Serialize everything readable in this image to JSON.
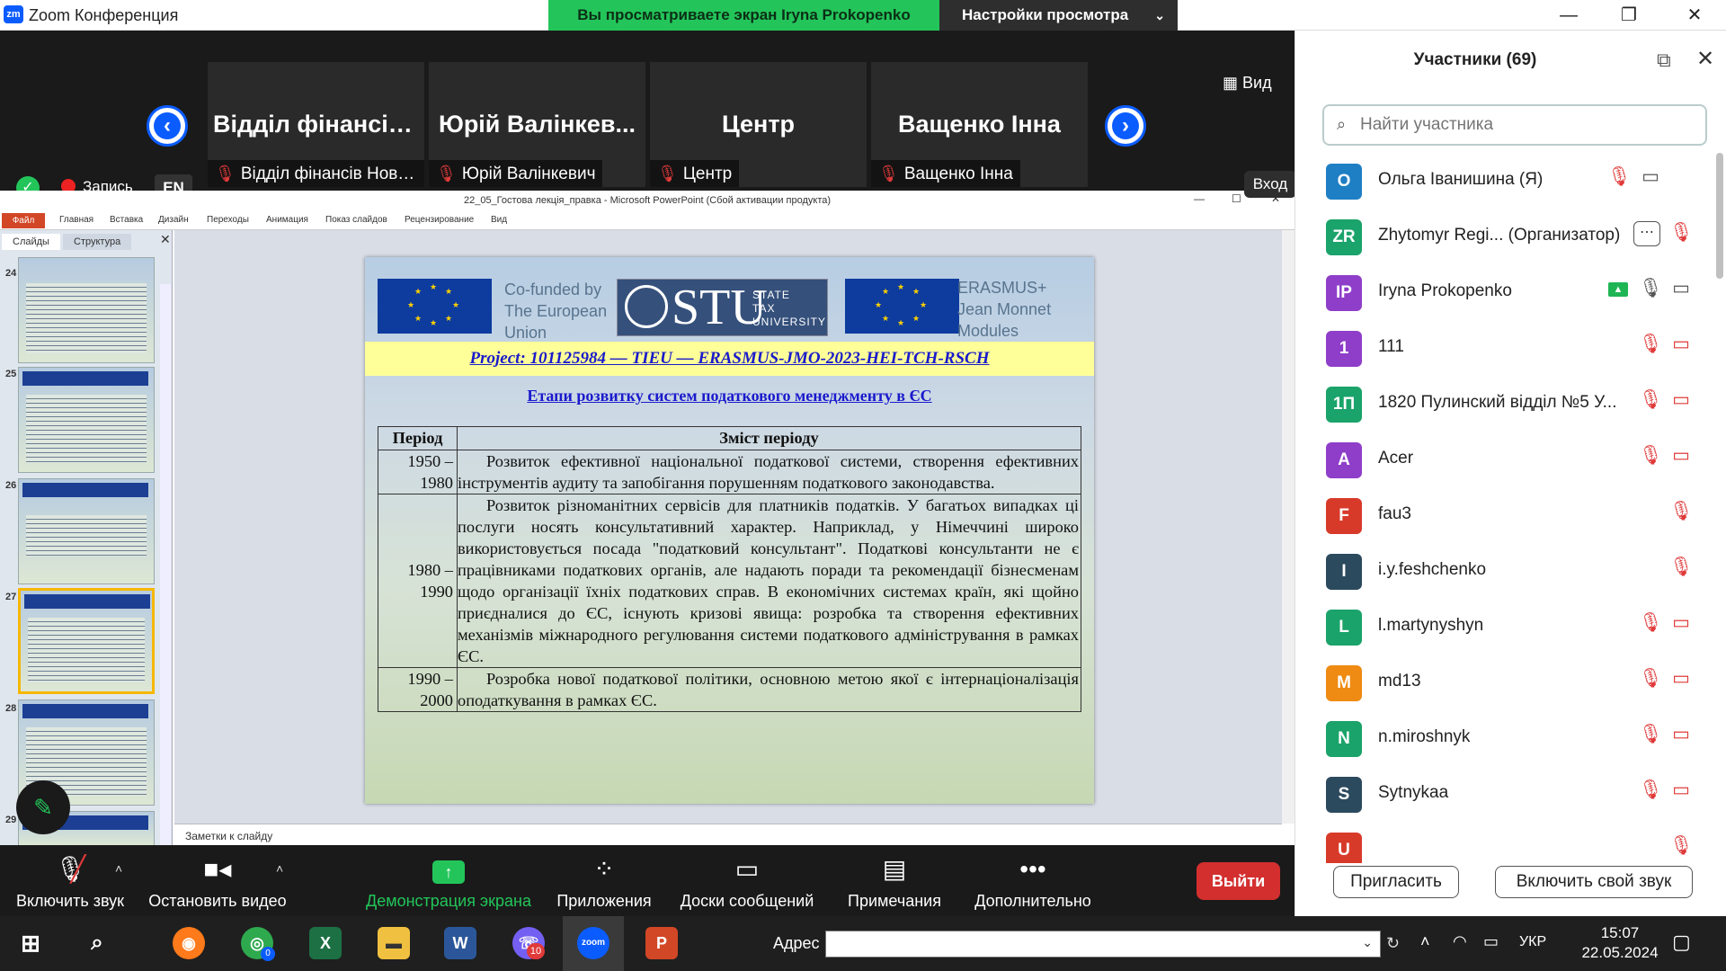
{
  "window": {
    "app_title": "Zoom Конференция",
    "share_banner": "Вы просматриваете экран Iryna Prokopenko",
    "view_options": "Настройки просмотра",
    "minimize": "—",
    "maximize": "❐",
    "close": "✕"
  },
  "gallery": {
    "view_label": "Вид",
    "enter_label": "Вход",
    "recording": "Запись",
    "language": "EN",
    "tiles": [
      {
        "big": "Відділ фінансів...",
        "label": "Відділ фінансів Новог..."
      },
      {
        "big": "Юрій Валінкев...",
        "label": "Юрій Валінкевич"
      },
      {
        "big": "Центр",
        "label": "Центр"
      },
      {
        "big": "Ващенко Інна",
        "label": "Ващенко Інна"
      }
    ]
  },
  "ppt": {
    "window_title": "22_05_Гостова лекція_правка - Microsoft PowerPoint (Сбой активации продукта)",
    "ribbon_tabs": [
      "Главная",
      "Вставка",
      "Дизайн",
      "Переходы",
      "Анимация",
      "Показ слайдов",
      "Рецензирование",
      "Вид"
    ],
    "file_tab": "Файл",
    "panel_tabs": [
      "Слайды",
      "Структура"
    ],
    "slide_numbers": [
      "24",
      "25",
      "26",
      "27",
      "28",
      "29"
    ],
    "notes_placeholder": "Заметки к слайду"
  },
  "slide": {
    "cofunded": [
      "Co-funded by",
      "The European",
      "Union"
    ],
    "stu_logo": "STU",
    "stu_sub": [
      "STATE",
      "TAX",
      "UNIVERSITY"
    ],
    "erasmus": [
      "ERASMUS+",
      "Jean Monnet",
      "Modules"
    ],
    "project": "Project:  101125984 — TIEU — ERASMUS-JMO-2023-HEI-TCH-RSCH",
    "title": "Етапи розвитку систем податкового менеджменту в ЄС",
    "header_period": "Період",
    "header_content": "Зміст періоду",
    "rows": [
      {
        "period": "1950 – 1980",
        "text": "Розвиток ефективної національної податкової системи, створення ефективних інструментів аудиту та запобігання порушенням податкового законодавства."
      },
      {
        "period": "1980 – 1990",
        "text": "Розвиток різноманітних сервісів для платників податків. У багатьох випадках ці послуги носять консультативний характер. Наприклад, у Німеччині широко використовується посада \"податковий консультант\". Податкові консультанти не є працівниками податкових органів, але надають поради та рекомендації бізнесменам щодо організації їхніх податкових справ. В економічних системах країн, які щойно приєдналися до ЄС, існують кризові явища: розробка та створення ефективних механізмів міжнародного регулювання системи податкового адміністрування в рамках ЄС."
      },
      {
        "period": "1990 – 2000",
        "text": "Розробка нової податкової політики, основною метою якої є інтернаціоналізація оподаткування в рамках ЄС."
      }
    ]
  },
  "participants": {
    "title": "Участники (69)",
    "search_placeholder": "Найти участника",
    "invite": "Пригласить",
    "unmute_me": "Включить свой звук",
    "list": [
      {
        "initials": "О",
        "name": "Ольга Іванишина (Я)",
        "color": "#1e7fc4"
      },
      {
        "initials": "ZR",
        "name": "Zhytomyr Regi... (Организатор)",
        "color": "#1aa36a"
      },
      {
        "initials": "IP",
        "name": "Iryna Prokopenko",
        "color": "#8e3ec9"
      },
      {
        "initials": "1",
        "name": "111",
        "color": "#8e3ec9"
      },
      {
        "initials": "1П",
        "name": "1820 Пулинский відділ №5 У...",
        "color": "#1aa36a"
      },
      {
        "initials": "A",
        "name": "Acer",
        "color": "#8e3ec9"
      },
      {
        "initials": "F",
        "name": "fau3",
        "color": "#d83a2a"
      },
      {
        "initials": "I",
        "name": "i.y.feshchenko",
        "color": "#2c4a5e"
      },
      {
        "initials": "L",
        "name": "l.martynyshyn",
        "color": "#1aa36a"
      },
      {
        "initials": "M",
        "name": "md13",
        "color": "#ef8a12"
      },
      {
        "initials": "N",
        "name": "n.miroshnyk",
        "color": "#1aa36a"
      },
      {
        "initials": "S",
        "name": "Sytnykaa",
        "color": "#2c4a5e"
      },
      {
        "initials": "U",
        "name": "",
        "color": "#d83a2a"
      }
    ]
  },
  "toolbar": {
    "mute": "Включить звук",
    "video": "Остановить видео",
    "share": "Демонстрация экрана",
    "apps": "Приложения",
    "whiteboards": "Доски сообщений",
    "notes": "Примечания",
    "more": "Дополнительно",
    "leave": "Выйти"
  },
  "taskbar": {
    "address_label": "Адрес",
    "language": "УКР",
    "time": "15:07",
    "date": "22.05.2024",
    "viber_badge": "10",
    "chrome_badge": "0"
  }
}
